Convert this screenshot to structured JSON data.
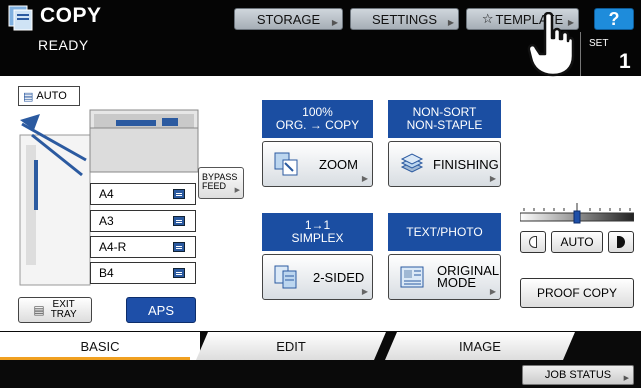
{
  "header": {
    "title": "COPY",
    "status": "READY",
    "buttons": {
      "storage": "STORAGE",
      "settings": "SETTINGS",
      "template": "TEMPLATE",
      "help": "?"
    },
    "set_label": "SET",
    "set_count": "1"
  },
  "machine": {
    "auto_label": "AUTO",
    "trays": [
      "A4",
      "A3",
      "A4-R",
      "B4"
    ],
    "bypass_label_1": "BYPASS",
    "bypass_label_2": "FEED",
    "exit_tray_1": "EXIT",
    "exit_tray_2": "TRAY",
    "aps_label": "APS"
  },
  "functions": {
    "zoom_head_1": "100%",
    "zoom_head_2": "ORG. → COPY",
    "zoom_label": "ZOOM",
    "finishing_head_1": "NON-SORT",
    "finishing_head_2": "NON-STAPLE",
    "finishing_label": "FINISHING",
    "sided_head_1": "1→1",
    "sided_head_2": "SIMPLEX",
    "sided_label": "2-SIDED",
    "mode_head": "TEXT/PHOTO",
    "mode_label_1": "ORIGINAL",
    "mode_label_2": "MODE"
  },
  "density": {
    "auto_label": "AUTO",
    "level": 0.5
  },
  "proof_copy": "PROOF COPY",
  "tabs": {
    "basic": "BASIC",
    "edit": "EDIT",
    "image": "IMAGE"
  },
  "footer": {
    "job_status": "JOB STATUS"
  },
  "colors": {
    "accent_blue": "#1b4ea2",
    "help_blue": "#1e8cdb",
    "tab_underline": "#f0a020"
  }
}
